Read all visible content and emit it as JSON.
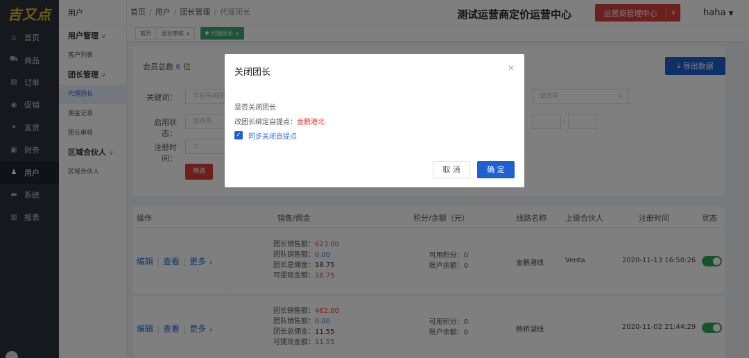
{
  "sidebar": {
    "logo": "吉又点",
    "items": [
      {
        "icon": "home-icon",
        "glyph": "⌂",
        "label": "首页"
      },
      {
        "icon": "cart-icon",
        "glyph": "⛟",
        "label": "商品"
      },
      {
        "icon": "order-icon",
        "glyph": "▤",
        "label": "订单"
      },
      {
        "icon": "promo-icon",
        "glyph": "◉",
        "label": "促销"
      },
      {
        "icon": "delivery-icon",
        "glyph": "⚭",
        "label": "发货"
      },
      {
        "icon": "finance-icon",
        "glyph": "▣",
        "label": "财务"
      },
      {
        "icon": "user-icon",
        "glyph": "♟",
        "label": "用户"
      },
      {
        "icon": "system-icon",
        "glyph": "▬",
        "label": "系统"
      },
      {
        "icon": "report-icon",
        "glyph": "▥",
        "label": "报表"
      }
    ],
    "active_index": 6
  },
  "subnav": {
    "title": "用户",
    "groups": [
      {
        "label": "用户管理",
        "links": [
          "客户列表"
        ]
      },
      {
        "label": "团长管理",
        "links": [
          "代理团长",
          "佣金记录",
          "团长审核"
        ]
      },
      {
        "label": "区域合伙人",
        "links": [
          "区域合伙人"
        ]
      }
    ],
    "active_link": "代理团长"
  },
  "header": {
    "breadcrumb": [
      "首页",
      "用户",
      "团长管理",
      "代理团长"
    ],
    "center_title": "测试运营商定价运营中心",
    "ops_button": "运营商管理中心",
    "username": "haha"
  },
  "tabs": [
    {
      "label": "首页",
      "closable": false
    },
    {
      "label": "团长审核",
      "closable": true
    },
    {
      "label": "代理团长",
      "closable": true,
      "active": true
    }
  ],
  "summary": {
    "label": "会员总数",
    "count": "6",
    "unit": "位"
  },
  "export_label": "导出数据",
  "filters": {
    "keyword_label": "关键词：",
    "keyword_placeholder": "手机号/昵称",
    "status_label": "启用状态：",
    "status_placeholder": "请选择",
    "regtime_label": "注册时间：",
    "right_select_placeholder": "请选择",
    "range_sep": "-",
    "filter_button": "筛选"
  },
  "table": {
    "headers": [
      "操作",
      "销售/佣金",
      "积分/余额（元）",
      "线路名称",
      "上级合伙人",
      "注册时间",
      "状态"
    ],
    "op_edit": "编辑",
    "op_view": "查看",
    "op_more": "更多",
    "sales_labels": [
      "团长销售额：",
      "团队销售额：",
      "团长总佣金：",
      "可提现金额："
    ],
    "points_labels": [
      "可用积分：",
      "账户余额："
    ],
    "rows": [
      {
        "leader_sales": "623.00",
        "team_sales": "0.00",
        "commission": "18.75",
        "withdrawable": "18.75",
        "points": "0",
        "balance": "0",
        "route": "金鹏港线",
        "partner": "Venta",
        "reg_time": "2020-11-13 16:50:26",
        "enabled": true
      },
      {
        "leader_sales": "462.00",
        "team_sales": "0.00",
        "commission": "11.55",
        "withdrawable": "11.55",
        "points": "0",
        "balance": "0",
        "route": "杨桥湖线",
        "partner": "",
        "reg_time": "2020-11-02 21:44:29",
        "enabled": true
      }
    ]
  },
  "modal": {
    "title": "关闭团长",
    "question": "是否关闭团长",
    "pickup_prefix": "改团长绑定自提点：",
    "pickup_name": "金鹏港北",
    "sync_label": "同步关闭自提点",
    "sync_checked": true,
    "cancel": "取 消",
    "confirm": "确 定"
  },
  "colors": {
    "primary": "#1e5fd1",
    "danger": "#d6403b",
    "success": "#28a65b",
    "sidebar": "#2b323b",
    "highlight_red": "#e03a36",
    "team_blue": "#2f6fd6",
    "pink": "#e0399b"
  }
}
